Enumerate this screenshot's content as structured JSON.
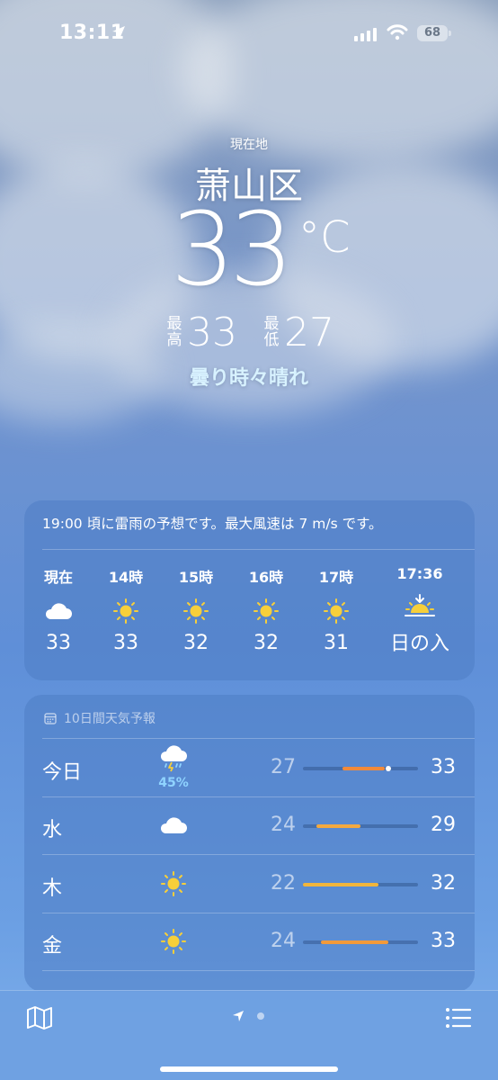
{
  "status_bar": {
    "time": "13:11",
    "battery": "68"
  },
  "header": {
    "location_label": "現在地",
    "city": "萧山区",
    "temperature": "33",
    "unit": "°C",
    "high_label": "最高",
    "high": "33",
    "low_label": "最低",
    "low": "27",
    "condition": "曇り時々晴れ"
  },
  "hourly": {
    "alert": "19:00 頃に雷雨の予想です。最大風速は 7 m/s です。",
    "items": [
      {
        "label": "現在",
        "icon": "cloud-icon",
        "temp": "33"
      },
      {
        "label": "14時",
        "icon": "sun-icon",
        "temp": "33"
      },
      {
        "label": "15時",
        "icon": "sun-icon",
        "temp": "32"
      },
      {
        "label": "16時",
        "icon": "sun-icon",
        "temp": "32"
      },
      {
        "label": "17時",
        "icon": "sun-icon",
        "temp": "31"
      },
      {
        "label": "17:36",
        "icon": "sunset-icon",
        "temp": "日の入"
      }
    ]
  },
  "daily": {
    "header": "10日間天気予報",
    "rows": [
      {
        "day": "今日",
        "icon": "thunderstorm-icon",
        "precip": "45%",
        "low": "27",
        "high": "33"
      },
      {
        "day": "水",
        "icon": "cloud-icon",
        "precip": "",
        "low": "24",
        "high": "29"
      },
      {
        "day": "木",
        "icon": "sun-icon",
        "precip": "",
        "low": "22",
        "high": "32"
      },
      {
        "day": "金",
        "icon": "sun-icon",
        "precip": "",
        "low": "24",
        "high": "33"
      }
    ],
    "range_fraction": [
      {
        "start": 0.34,
        "end": 0.71,
        "current": 0.74,
        "color": "#f28a3a"
      },
      {
        "start": 0.12,
        "end": 0.5,
        "current": null,
        "color": "#f4a93f"
      },
      {
        "start": 0.0,
        "end": 0.66,
        "current": null,
        "color": "#f2b53b"
      },
      {
        "start": 0.16,
        "end": 0.74,
        "current": null,
        "color": "#f29a3a"
      }
    ]
  },
  "colors": {
    "sky_top": "#8a9fbd",
    "sky_bottom": "#6b9fe3",
    "sun": "#f7cf3a",
    "precip": "#8fd3ff"
  }
}
